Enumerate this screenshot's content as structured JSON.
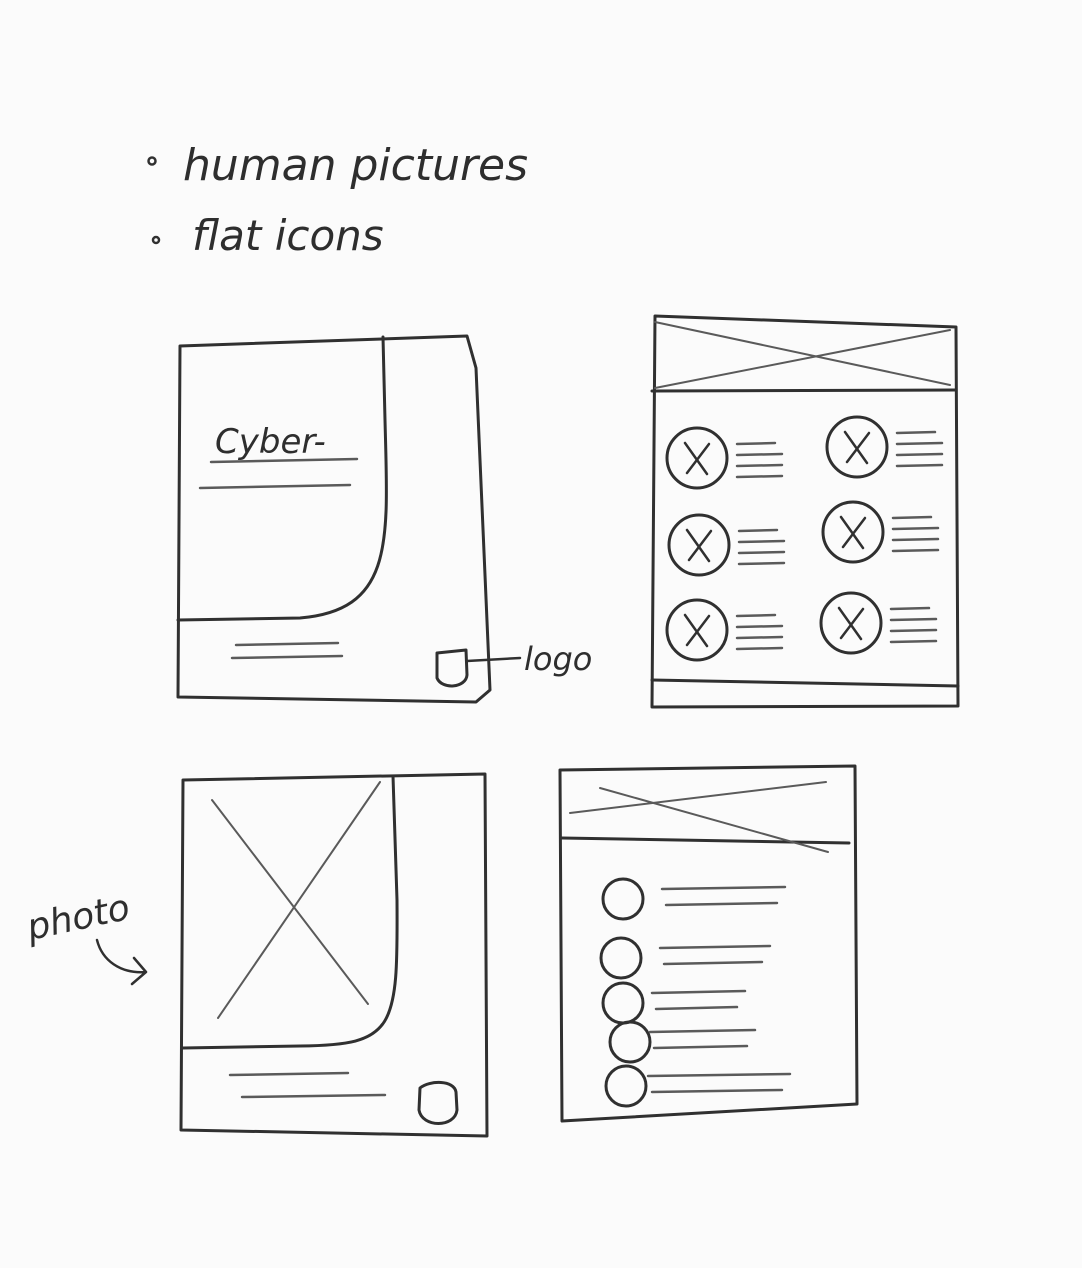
{
  "notes": {
    "items": [
      {
        "text": "human pictures"
      },
      {
        "text": "flat icons"
      }
    ]
  },
  "annotations": {
    "cyber_text": "Cyber-",
    "logo_label": "logo",
    "photo_label": "photo"
  },
  "colors": {
    "paper": "#fbfbfb",
    "ink": "#303030"
  }
}
